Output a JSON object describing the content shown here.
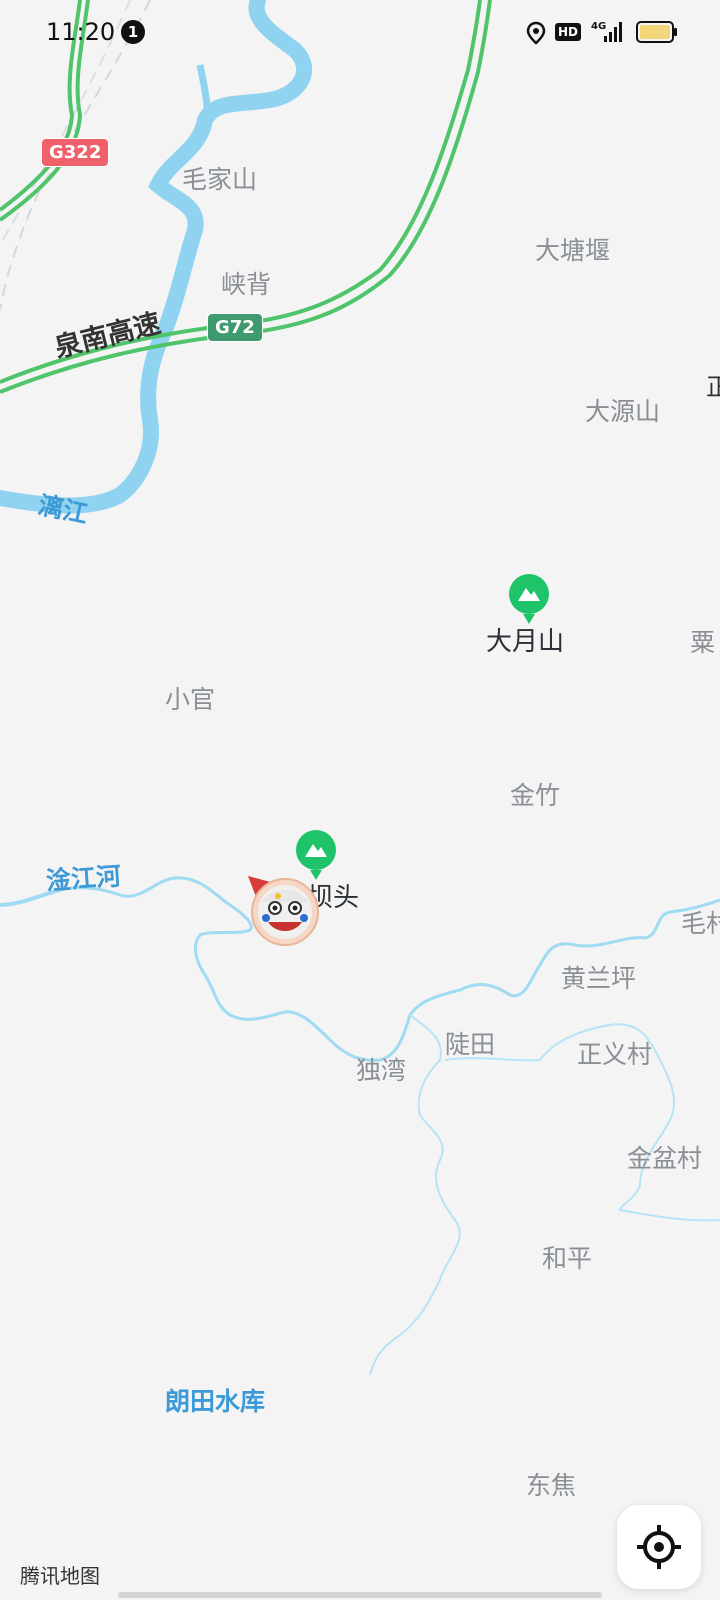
{
  "status_bar": {
    "time": "11:20",
    "notification_count": "1",
    "hd_badge": "HD",
    "network": "4G"
  },
  "map": {
    "roads": {
      "expressway_name": "泉南高速",
      "shield_g322": "G322",
      "shield_g72": "G72",
      "g322_color": "#f0606a",
      "g72_color": "#3f9a70",
      "expressway_color": "#4fc46a"
    },
    "water": {
      "river_li": "漓江",
      "river_ganjiang": "淦江河",
      "reservoir": "朗田水库",
      "water_color": "#8fd3f0"
    },
    "places": {
      "maojiashan": "毛家山",
      "xiabei": "峡背",
      "datangyan": "大塘堰",
      "dayuanshan": "大源山",
      "dayueshan": "大月山",
      "xiaoguan": "小官",
      "jinzhu": "金竹",
      "kengtou_partial": "坝头",
      "huanglanping": "黄兰坪",
      "dutian": "陡田",
      "duwan": "独湾",
      "zhengyicun": "正义村",
      "jinpencun": "金盆村",
      "heping": "和平",
      "dongjiao": "东焦",
      "edge_li": "粟",
      "edge_zheng": "正",
      "edge_mao": "毛村"
    },
    "poi_color": "#1fc36a",
    "watermark": "腾讯地图"
  },
  "controls": {
    "locate_icon": "crosshair-icon"
  }
}
